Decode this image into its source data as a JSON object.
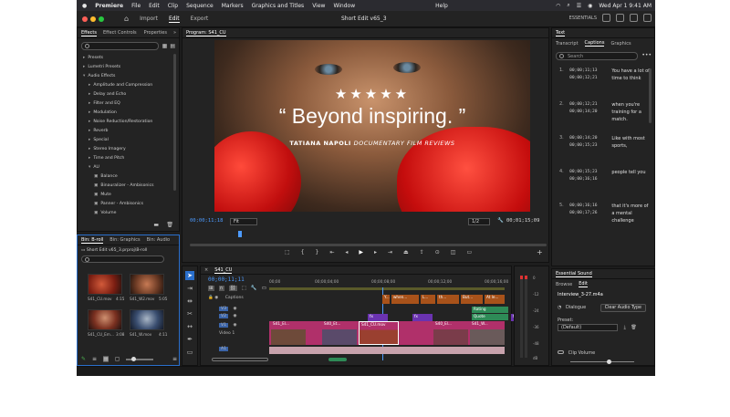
{
  "menubar": {
    "app_name": "Premiere",
    "items": [
      "File",
      "Edit",
      "Clip",
      "Sequence",
      "Markers",
      "Graphics and Titles",
      "View",
      "Window",
      "Help"
    ],
    "clock": "Wed Apr 1  9:41 AM"
  },
  "toolbar": {
    "tabs": [
      "Import",
      "Edit",
      "Export"
    ],
    "active_tab": "Edit",
    "document_title": "Short Edit v65_3",
    "workspace": "ESSENTIALS"
  },
  "effects": {
    "tabs": [
      "Effects",
      "Effect Controls",
      "Properties"
    ],
    "tree": [
      {
        "label": "Presets",
        "kind": "fold"
      },
      {
        "label": "Lumetri Presets",
        "kind": "fold"
      },
      {
        "label": "Audio Effects",
        "kind": "open"
      },
      {
        "label": "Amplitude and Compression",
        "kind": "fold"
      },
      {
        "label": "Delay and Echo",
        "kind": "fold"
      },
      {
        "label": "Filter and EQ",
        "kind": "fold"
      },
      {
        "label": "Modulation",
        "kind": "fold"
      },
      {
        "label": "Noise Reduction/Restoration",
        "kind": "fold"
      },
      {
        "label": "Reverb",
        "kind": "fold"
      },
      {
        "label": "Special",
        "kind": "fold"
      },
      {
        "label": "Stereo Imagery",
        "kind": "fold"
      },
      {
        "label": "Time and Pitch",
        "kind": "fold"
      },
      {
        "label": "AU",
        "kind": "open"
      },
      {
        "label": "Balance",
        "kind": "fx"
      },
      {
        "label": "Binauralizer - Ambisonics",
        "kind": "fx"
      },
      {
        "label": "Mute",
        "kind": "fx"
      },
      {
        "label": "Panner - Ambisonics",
        "kind": "fx"
      },
      {
        "label": "Volume",
        "kind": "fx"
      }
    ]
  },
  "program": {
    "title": "Program: S41_CU",
    "stars": "★★★★★",
    "quote": "“ Beyond inspiring. ”",
    "credit_a": "TATIANA NAPOLI",
    "credit_b": "DOCUMENTARY FILM REVIEWS",
    "timecode_in": "00;00;11;18",
    "fit": "Fit",
    "resolution": "1/2",
    "timecode_out": "00;01;15;09"
  },
  "text_panel": {
    "title": "Text",
    "tabs": [
      "Transcript",
      "Captions",
      "Graphics"
    ],
    "active_tab": "Captions",
    "search_placeholder": "Search",
    "captions": [
      {
        "n": "1.",
        "in": "00;00;11;13",
        "out": "00;00;12;21",
        "text": "You have a lot of time to think"
      },
      {
        "n": "2.",
        "in": "00;00;12;21",
        "out": "00;00;14;20",
        "text": "when you're training for a match."
      },
      {
        "n": "3.",
        "in": "00;00;14;20",
        "out": "00;00;15;23",
        "text": "Like with most sports,"
      },
      {
        "n": "4.",
        "in": "00;00;15;23",
        "out": "00;00;16;16",
        "text": "people tell you"
      },
      {
        "n": "5.",
        "in": "00;00;16;16",
        "out": "00;00;17;26",
        "text": "that it's more of a mental challenge"
      }
    ]
  },
  "bin": {
    "tabs": [
      "Bin: B-roll",
      "Bin: Graphics",
      "Bin: Audio"
    ],
    "path": "Short Edit v65_3.prproj\\B-roll",
    "search_placeholder": "",
    "clips": [
      {
        "name": "S41_CU.mov",
        "dur": "4:15"
      },
      {
        "name": "S41_W2.mov",
        "dur": "5:05"
      },
      {
        "name": "S41_CU_Em...",
        "dur": "3:08"
      },
      {
        "name": "S41_W.mov",
        "dur": "4:11"
      }
    ]
  },
  "timeline": {
    "title": "S41_CU",
    "timecode": "00;00;11;11",
    "ruler": [
      "00;00",
      "00;00;04;00",
      "00;00;08;00",
      "00;00;12;00",
      "00;00;16;00"
    ],
    "tracks": [
      "Captions",
      "V3",
      "V2",
      "V1",
      "A1"
    ],
    "v1_label": "Video 1",
    "clips_v1": [
      "S41_El...",
      "S40_Et...",
      "S41_CU.mov",
      "S40_El...",
      "S41_W..."
    ],
    "clips_v3": [
      "Rating"
    ],
    "clips_v2": [
      "Quote"
    ],
    "captions_text": [
      "Y...",
      "when...",
      "L...",
      "th...",
      "But...",
      "At le..."
    ],
    "fx_label": "fx"
  },
  "meter": {
    "labels": [
      "0",
      "-12",
      "-24",
      "-36",
      "-48",
      "dB"
    ]
  },
  "essential_sound": {
    "title": "Essential Sound",
    "tabs": [
      "Browse",
      "Edit"
    ],
    "active_tab": "Edit",
    "clip": "Interview_3-27.m4a",
    "type": "Dialogue",
    "clear_btn": "Clear Audio Type",
    "preset_label": "Preset:",
    "preset_value": "(Default)",
    "clip_volume": "Clip Volume"
  }
}
